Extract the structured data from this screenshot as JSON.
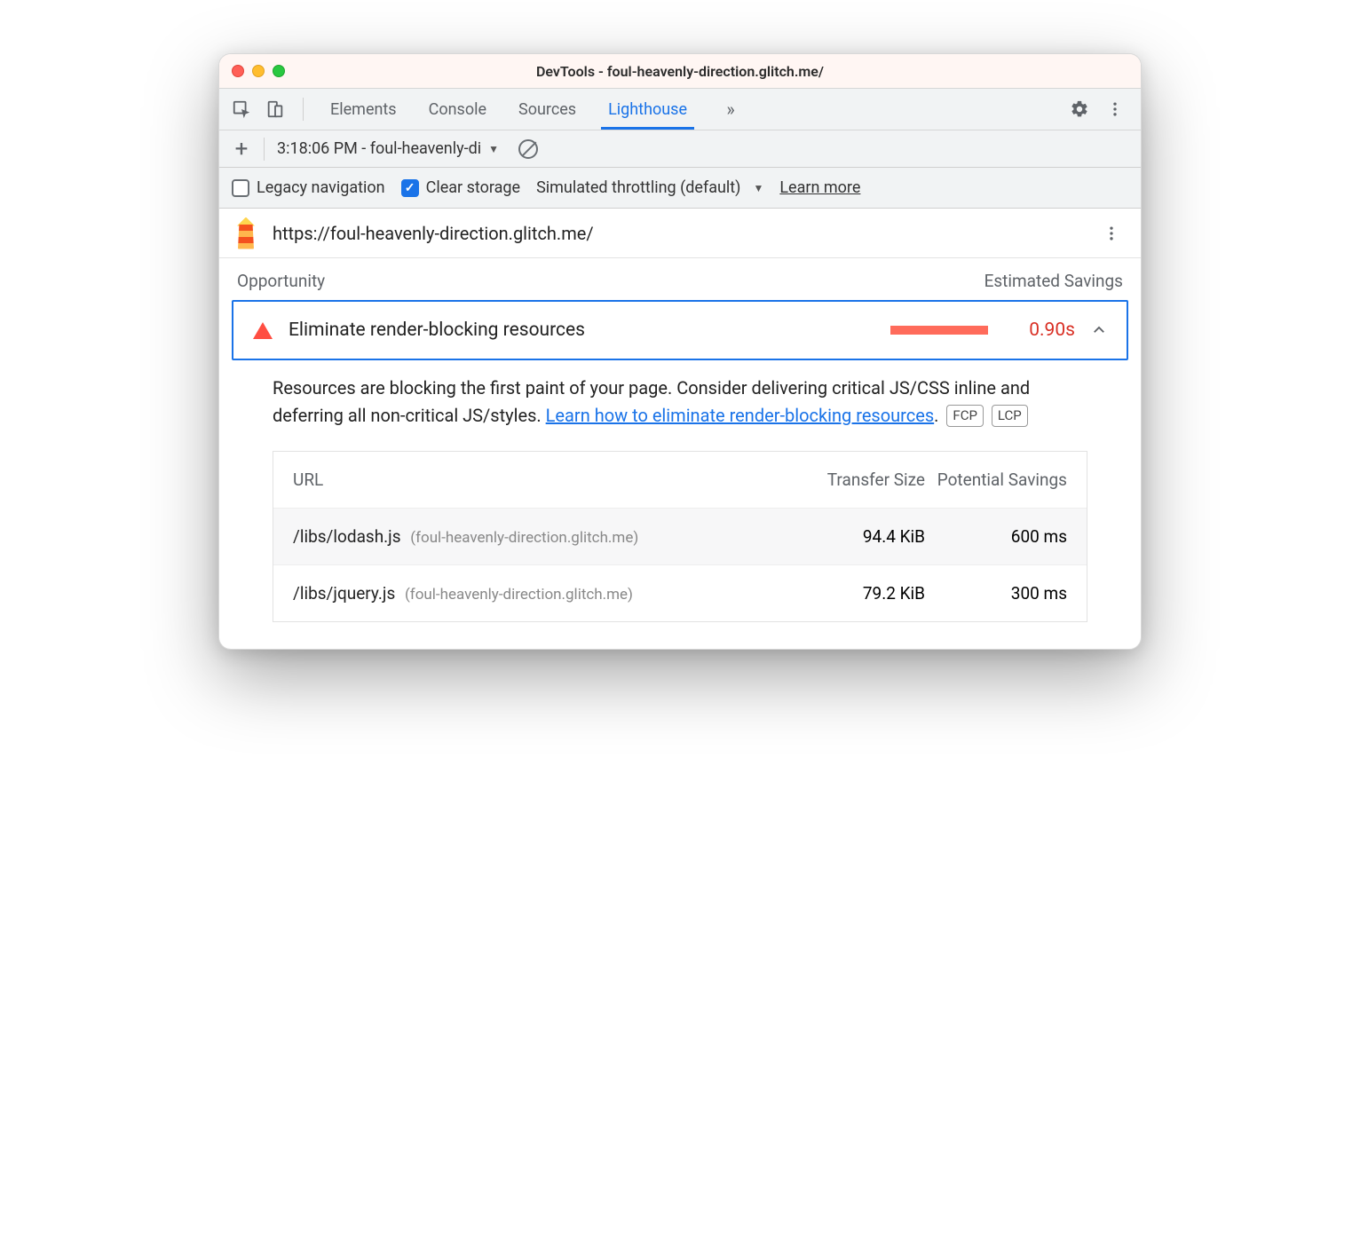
{
  "window": {
    "title": "DevTools - foul-heavenly-direction.glitch.me/"
  },
  "tabs": {
    "items": [
      "Elements",
      "Console",
      "Sources",
      "Lighthouse"
    ],
    "active": "Lighthouse"
  },
  "subbar": {
    "run_label": "3:18:06 PM - foul-heavenly-di"
  },
  "options": {
    "legacy_label": "Legacy navigation",
    "legacy_checked": false,
    "clear_label": "Clear storage",
    "clear_checked": true,
    "throttle_label": "Simulated throttling (default)",
    "learn_more": "Learn more"
  },
  "urlbar": {
    "url": "https://foul-heavenly-direction.glitch.me/"
  },
  "section": {
    "left": "Opportunity",
    "right": "Estimated Savings"
  },
  "audit": {
    "title": "Eliminate render-blocking resources",
    "value": "0.90s",
    "desc_before": "Resources are blocking the first paint of your page. Consider delivering critical JS/CSS inline and deferring all non-critical JS/styles. ",
    "desc_link": "Learn how to eliminate render-blocking resources",
    "desc_after": ".",
    "tags": [
      "FCP",
      "LCP"
    ]
  },
  "table": {
    "headers": {
      "url": "URL",
      "size": "Transfer Size",
      "savings": "Potential Savings"
    },
    "rows": [
      {
        "path": "/libs/lodash.js",
        "host": "(foul-heavenly-direction.glitch.me)",
        "size": "94.4 KiB",
        "savings": "600 ms"
      },
      {
        "path": "/libs/jquery.js",
        "host": "(foul-heavenly-direction.glitch.me)",
        "size": "79.2 KiB",
        "savings": "300 ms"
      }
    ]
  }
}
